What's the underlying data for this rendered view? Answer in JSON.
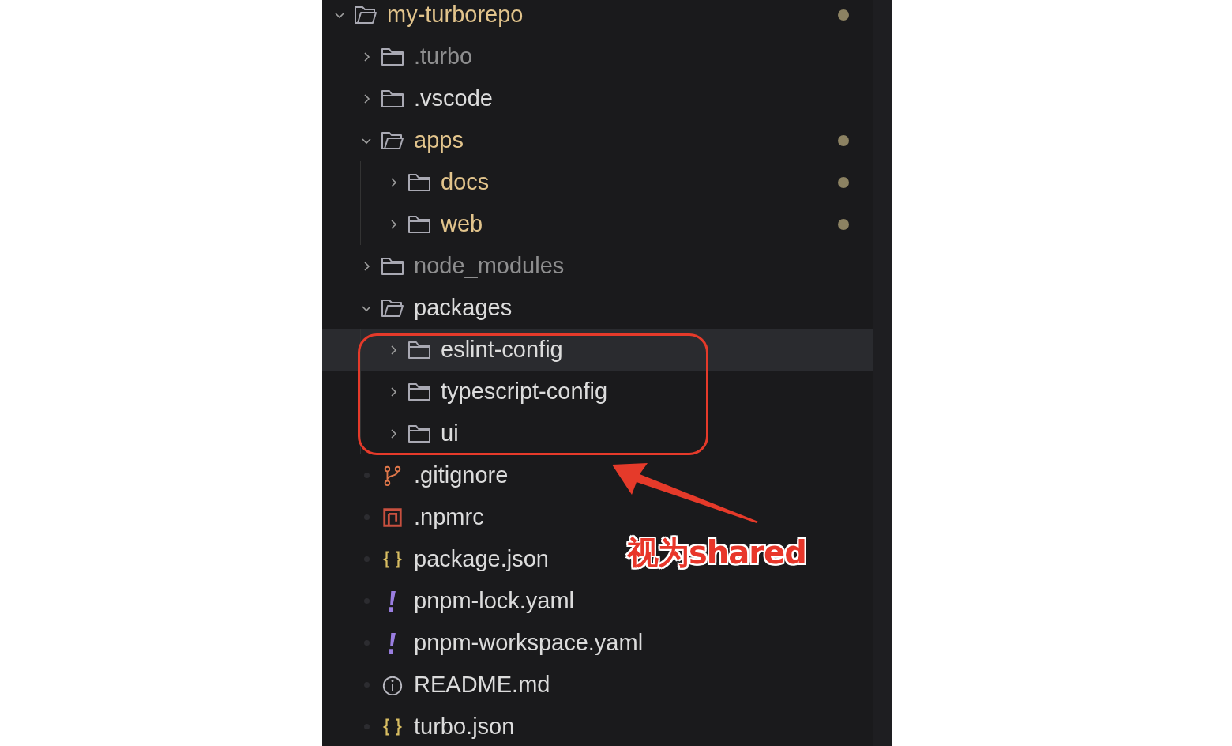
{
  "tree": [
    {
      "name": "my-turborepo",
      "kind": "folder",
      "expanded": true,
      "modified": true,
      "ignored": false,
      "selected": false,
      "children": [
        {
          "name": ".turbo",
          "kind": "folder",
          "expanded": false,
          "modified": false,
          "ignored": true,
          "selected": false
        },
        {
          "name": ".vscode",
          "kind": "folder",
          "expanded": false,
          "modified": false,
          "ignored": false,
          "selected": false
        },
        {
          "name": "apps",
          "kind": "folder",
          "expanded": true,
          "modified": true,
          "ignored": false,
          "selected": false,
          "children": [
            {
              "name": "docs",
              "kind": "folder",
              "expanded": false,
              "modified": true,
              "ignored": false,
              "selected": false
            },
            {
              "name": "web",
              "kind": "folder",
              "expanded": false,
              "modified": true,
              "ignored": false,
              "selected": false
            }
          ]
        },
        {
          "name": "node_modules",
          "kind": "folder",
          "expanded": false,
          "modified": false,
          "ignored": true,
          "selected": false
        },
        {
          "name": "packages",
          "kind": "folder",
          "expanded": true,
          "modified": false,
          "ignored": false,
          "selected": false,
          "children": [
            {
              "name": "eslint-config",
              "kind": "folder",
              "expanded": false,
              "modified": false,
              "ignored": false,
              "selected": true
            },
            {
              "name": "typescript-config",
              "kind": "folder",
              "expanded": false,
              "modified": false,
              "ignored": false,
              "selected": false
            },
            {
              "name": "ui",
              "kind": "folder",
              "expanded": false,
              "modified": false,
              "ignored": false,
              "selected": false
            }
          ]
        },
        {
          "name": ".gitignore",
          "kind": "git",
          "modified": false,
          "ignored": false,
          "selected": false
        },
        {
          "name": ".npmrc",
          "kind": "npm",
          "modified": false,
          "ignored": false,
          "selected": false
        },
        {
          "name": "package.json",
          "kind": "json",
          "modified": false,
          "ignored": false,
          "selected": false
        },
        {
          "name": "pnpm-lock.yaml",
          "kind": "yaml",
          "modified": false,
          "ignored": false,
          "selected": false
        },
        {
          "name": "pnpm-workspace.yaml",
          "kind": "yaml",
          "modified": false,
          "ignored": false,
          "selected": false
        },
        {
          "name": "README.md",
          "kind": "info",
          "modified": false,
          "ignored": false,
          "selected": false
        },
        {
          "name": "turbo.json",
          "kind": "json",
          "modified": false,
          "ignored": false,
          "selected": false
        }
      ]
    }
  ],
  "annotation": {
    "text": "视为shared"
  }
}
